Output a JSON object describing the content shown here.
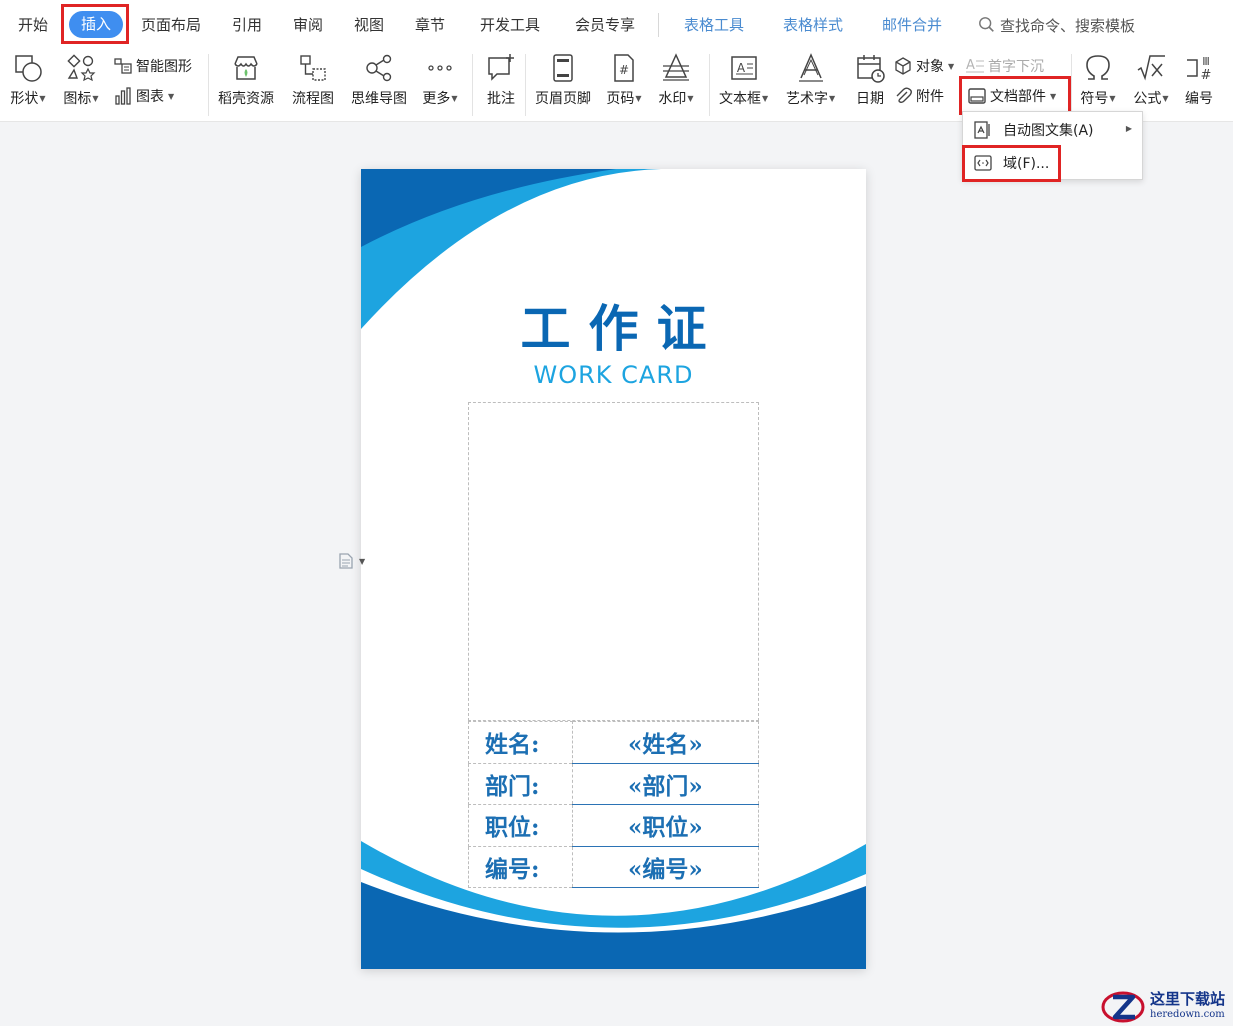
{
  "menubar": {
    "items": [
      "开始",
      "插入",
      "页面布局",
      "引用",
      "审阅",
      "视图",
      "章节",
      "开发工具",
      "会员专享"
    ],
    "active": "插入",
    "tool_tabs": [
      "表格工具",
      "表格样式",
      "邮件合并"
    ],
    "search_placeholder": "查找命令、搜索模板"
  },
  "ribbon": {
    "shape": "形状",
    "icons": "图标",
    "smart_art": "智能图形",
    "chart": "图表",
    "docer_resources": "稻壳资源",
    "flowchart": "流程图",
    "mindmap": "思维导图",
    "more": "更多",
    "comment": "批注",
    "header_footer": "页眉页脚",
    "page_number": "页码",
    "watermark": "水印",
    "textbox": "文本框",
    "wordart": "艺术字",
    "date": "日期",
    "object": "对象",
    "attachment": "附件",
    "drop_cap": "首字下沉",
    "doc_parts": "文档部件",
    "symbol": "符号",
    "formula": "公式",
    "numbering": "编号"
  },
  "dropdown": {
    "autotext": "自动图文集(A)",
    "field": "域(F)..."
  },
  "card": {
    "title": "工作证",
    "subtitle": "WORK CARD",
    "rows": [
      {
        "label": "姓名:",
        "value": "«姓名»"
      },
      {
        "label": "部门:",
        "value": "«部门»"
      },
      {
        "label": "职位:",
        "value": "«职位»"
      },
      {
        "label": "编号:",
        "value": "«编号»"
      }
    ]
  },
  "watermark": {
    "cn": "这里下载站",
    "en": "heredown.com"
  },
  "colors": {
    "card_dark_blue": "#0a67b3",
    "card_light_blue": "#1da4e0",
    "highlight_red": "#e02424",
    "active_tab": "#3f8ef0"
  }
}
